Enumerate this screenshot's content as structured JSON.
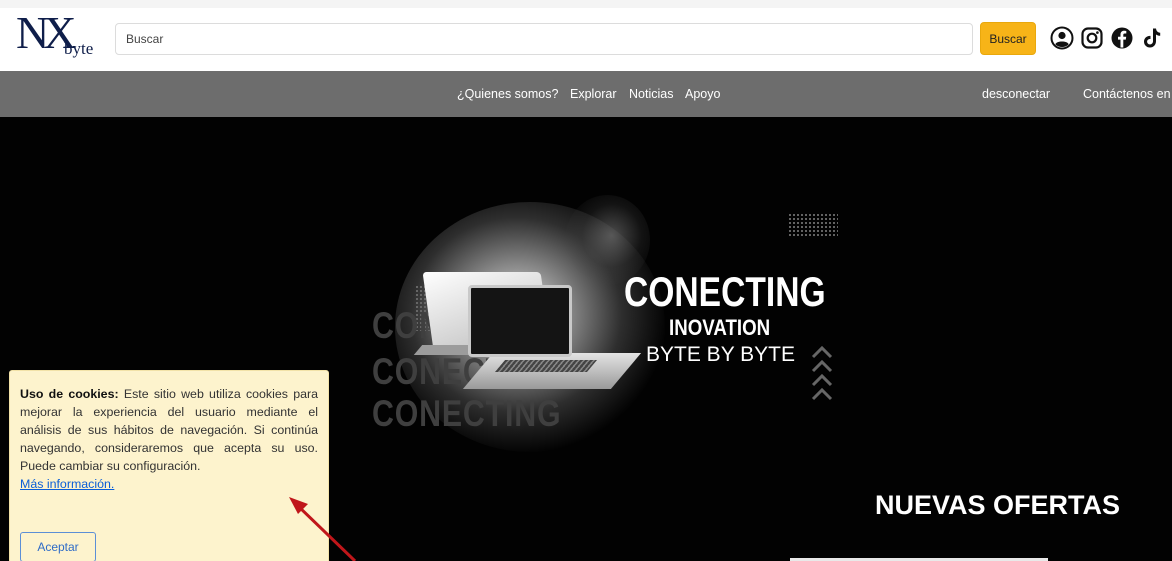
{
  "header": {
    "logo_main": "NX",
    "logo_sub": "byte",
    "search_placeholder": "Buscar",
    "search_button": "Buscar",
    "social_icons": [
      "user-circle-icon",
      "instagram-icon",
      "facebook-icon",
      "tiktok-icon"
    ]
  },
  "nav": {
    "items": [
      "¿Quienes somos?",
      "Explorar",
      "Noticias",
      "Apoyo"
    ],
    "right_items": [
      "desconectar",
      "Contáctenos en"
    ]
  },
  "hero": {
    "title": "CONECTING",
    "subtitle1": "INOVATION",
    "subtitle2": "BYTE BY BYTE",
    "ghost_text": [
      "CONE",
      "CONECTI",
      "CONECTING"
    ],
    "section_title": "NUEVAS OFERTAS"
  },
  "cookie": {
    "heading": "Uso de cookies:",
    "body": "Este sitio web utiliza cookies para mejorar la experiencia del usuario mediante el análisis de sus hábitos de navegación. Si continúa navegando, consideraremos que acepta su uso. Puede cambiar su configuración.",
    "link": "Más información.",
    "accept": "Aceptar"
  },
  "colors": {
    "accent": "#f7b418",
    "nav_bg": "#6d6d6d",
    "hero_bg": "#020202",
    "cookie_bg": "#fdf3cd",
    "annotation_arrow": "#c0161a"
  }
}
